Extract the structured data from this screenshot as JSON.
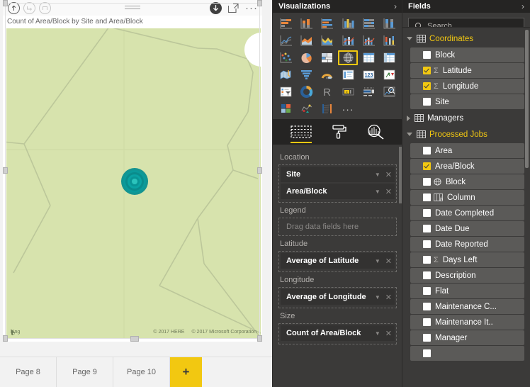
{
  "visual": {
    "title": "Count of Area/Block by Site and Area/Block",
    "toolbar": {
      "drill_up_icon": "drill-up-arrow-icon",
      "drill_down_icon": "drill-down-arrow-icon",
      "expand_hierarchy_icon": "expand-hierarchy-icon",
      "menu_icon": "hamburger-menu-icon",
      "download_icon": "download-circle-icon",
      "focus_icon": "focus-mode-icon",
      "more_icon": "more-options-ellipsis-icon"
    },
    "map": {
      "basemap_brand": "bing",
      "credits": [
        "© 2017 HERE",
        "© 2017 Microsoft Corporation"
      ],
      "bubble_color": "#069b9b",
      "land_color": "#d7e3ad",
      "road_color": "#bcc79a"
    }
  },
  "page_tabs": {
    "pages": [
      "Page 8",
      "Page 9",
      "Page 10"
    ],
    "add_label": "+"
  },
  "visualizations": {
    "header": "Visualizations",
    "collapse_icon": "chevron-right-icon",
    "gallery": [
      {
        "name": "stacked-bar-chart",
        "selected": false
      },
      {
        "name": "stacked-column-chart",
        "selected": false
      },
      {
        "name": "clustered-bar-chart",
        "selected": false
      },
      {
        "name": "clustered-column-chart",
        "selected": false
      },
      {
        "name": "100-percent-stacked-bar-chart",
        "selected": false
      },
      {
        "name": "100-percent-stacked-column-chart",
        "selected": false
      },
      {
        "name": "line-chart",
        "selected": false
      },
      {
        "name": "area-chart",
        "selected": false
      },
      {
        "name": "stacked-area-chart",
        "selected": false
      },
      {
        "name": "line-and-stacked-column-chart",
        "selected": false
      },
      {
        "name": "line-and-clustered-column-chart",
        "selected": false
      },
      {
        "name": "ribbon-chart",
        "selected": false
      },
      {
        "name": "scatter-chart",
        "selected": false
      },
      {
        "name": "pie-chart",
        "selected": false
      },
      {
        "name": "treemap-chart",
        "selected": false
      },
      {
        "name": "map-visual",
        "selected": true
      },
      {
        "name": "table-visual",
        "selected": false
      },
      {
        "name": "matrix-visual",
        "selected": false
      },
      {
        "name": "filled-map-visual",
        "selected": false
      },
      {
        "name": "funnel-chart",
        "selected": false
      },
      {
        "name": "gauge-chart",
        "selected": false
      },
      {
        "name": "multi-row-card",
        "selected": false
      },
      {
        "name": "card-visual",
        "selected": false
      },
      {
        "name": "kpi-visual",
        "selected": false
      },
      {
        "name": "slicer-visual",
        "selected": false
      },
      {
        "name": "donut-chart",
        "selected": false
      },
      {
        "name": "r-script-visual",
        "selected": false
      },
      {
        "name": "esri-maps-visual",
        "selected": false
      },
      {
        "name": "bullet-chart-visual",
        "selected": false
      },
      {
        "name": "key-influencers-visual",
        "selected": false
      },
      {
        "name": "power-kpi-matrix-visual",
        "selected": false
      },
      {
        "name": "sparkline-visual",
        "selected": false
      },
      {
        "name": "tornado-chart-visual",
        "selected": false
      },
      {
        "name": "more-visuals",
        "selected": false
      }
    ],
    "tabs": [
      {
        "name": "fields-tab",
        "icon": "fields-dashed-rectangle-icon",
        "active": true
      },
      {
        "name": "format-tab",
        "icon": "paint-roller-icon",
        "active": false
      },
      {
        "name": "analytics-tab",
        "icon": "analytics-magnifier-icon",
        "active": false
      }
    ],
    "wells": [
      {
        "label": "Location",
        "chips": [
          {
            "name": "Site"
          },
          {
            "name": "Area/Block"
          }
        ]
      },
      {
        "label": "Legend",
        "placeholder": "Drag data fields here",
        "chips": []
      },
      {
        "label": "Latitude",
        "chips": [
          {
            "name": "Average of Latitude"
          }
        ]
      },
      {
        "label": "Longitude",
        "chips": [
          {
            "name": "Average of Longitude"
          }
        ]
      },
      {
        "label": "Size",
        "chips": [
          {
            "name": "Count of Area/Block"
          }
        ]
      }
    ]
  },
  "fields": {
    "header": "Fields",
    "collapse_icon": "chevron-right-icon",
    "search": {
      "placeholder": "Search",
      "icon": "search-magnifier-icon",
      "value": ""
    },
    "tree": [
      {
        "table": "Coordinates",
        "expanded": true,
        "fields": [
          {
            "label": "Block",
            "checked": false,
            "measure": false,
            "icon": null
          },
          {
            "label": "Latitude",
            "checked": true,
            "measure": true,
            "icon": "sigma-icon"
          },
          {
            "label": "Longitude",
            "checked": true,
            "measure": true,
            "icon": "sigma-icon"
          },
          {
            "label": "Site",
            "checked": false,
            "measure": false,
            "icon": null
          }
        ]
      },
      {
        "table": "Managers",
        "expanded": false,
        "fields": []
      },
      {
        "table": "Processed Jobs",
        "expanded": true,
        "fields": [
          {
            "label": "Area",
            "checked": false,
            "measure": false,
            "icon": null
          },
          {
            "label": "Area/Block",
            "checked": true,
            "measure": false,
            "icon": null
          },
          {
            "label": "Block",
            "checked": false,
            "measure": false,
            "icon": "globe-geo-icon"
          },
          {
            "label": "Column",
            "checked": false,
            "measure": false,
            "icon": "calculated-column-icon"
          },
          {
            "label": "Date Completed",
            "checked": false,
            "measure": false,
            "icon": null
          },
          {
            "label": "Date Due",
            "checked": false,
            "measure": false,
            "icon": null
          },
          {
            "label": "Date Reported",
            "checked": false,
            "measure": false,
            "icon": null
          },
          {
            "label": "Days Left",
            "checked": false,
            "measure": true,
            "icon": "sigma-icon"
          },
          {
            "label": "Description",
            "checked": false,
            "measure": false,
            "icon": null
          },
          {
            "label": "Flat",
            "checked": false,
            "measure": false,
            "icon": null
          },
          {
            "label": "Maintenance C...",
            "checked": false,
            "measure": false,
            "icon": null
          },
          {
            "label": "Maintenance It..",
            "checked": false,
            "measure": false,
            "icon": null
          },
          {
            "label": "Manager",
            "checked": false,
            "measure": false,
            "icon": null
          }
        ]
      }
    ]
  },
  "colors": {
    "accent_yellow": "#f2c811",
    "pane_bg": "#3b3a39",
    "pane_header_bg": "#252423",
    "field_row_bg": "#5b5a58",
    "map_bubble": "#069b9b"
  }
}
